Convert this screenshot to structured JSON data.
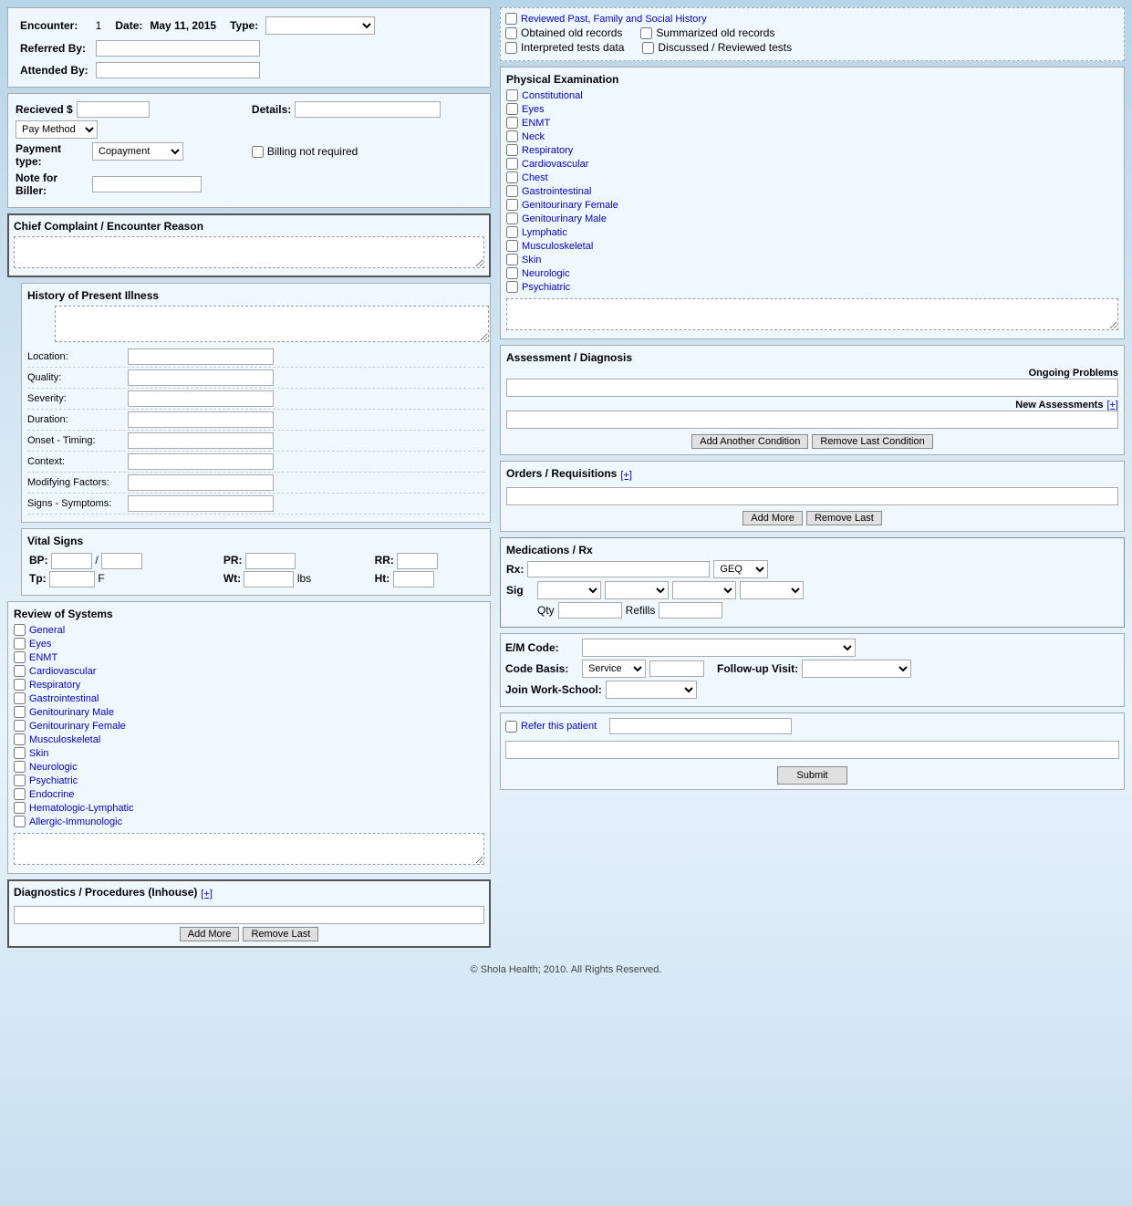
{
  "header": {
    "encounter_label": "Encounter:",
    "encounter_value": "1",
    "date_label": "Date:",
    "date_value": "May 11, 2015",
    "type_label": "Type:",
    "referred_by_label": "Referred By:",
    "attended_by_label": "Attended By:"
  },
  "billing": {
    "received_label": "Recieved $",
    "details_label": "Details:",
    "pay_method_label": "Pay Method",
    "payment_type_label": "Payment type:",
    "payment_type_value": "Copayment",
    "billing_not_required": "Billing not required",
    "note_for_biller_label": "Note for Biller:"
  },
  "chief_complaint": {
    "title": "Chief Complaint / Encounter Reason"
  },
  "hpi": {
    "title": "History of Present Illness",
    "location": "Location:",
    "quality": "Quality:",
    "severity": "Severity:",
    "duration": "Duration:",
    "onset_timing": "Onset - Timing:",
    "context": "Context:",
    "modifying_factors": "Modifying Factors:",
    "signs_symptoms": "Signs - Symptoms:"
  },
  "vital_signs": {
    "title": "Vital Signs",
    "bp": "BP:",
    "pr": "PR:",
    "rr": "RR:",
    "tp": "Tp:",
    "f": "F",
    "wt": "Wt:",
    "lbs": "lbs",
    "ht": "Ht:"
  },
  "review_of_systems": {
    "title": "Review of Systems",
    "items": [
      "General",
      "Eyes",
      "ENMT",
      "Cardiovascular",
      "Respiratory",
      "Gastrointestinal",
      "Genitourinary Male",
      "Genitourinary Female",
      "Musculoskeletal",
      "Skin",
      "Neurologic",
      "Psychiatric",
      "Endocrine",
      "Hematologic-Lymphatic",
      "Allergic-Immunologic"
    ]
  },
  "diagnostics": {
    "title": "Diagnostics / Procedures (Inhouse)",
    "plus": "[+]",
    "add_more": "Add More",
    "remove_last": "Remove Last"
  },
  "right_top": {
    "reviewed_past": "Reviewed Past, Family and Social History",
    "obtained_old": "Obtained old records",
    "summarized_old": "Summarized old records",
    "interpreted_tests": "Interpreted tests data",
    "discussed_reviewed": "Discussed / Reviewed tests"
  },
  "physical_exam": {
    "title": "Physical Examination",
    "items": [
      "Constitutional",
      "Eyes",
      "ENMT",
      "Neck",
      "Respiratory",
      "Cardiovascular",
      "Chest",
      "Gastrointestinal",
      "Genitourinary Female",
      "Genitourinary Male",
      "Lymphatic",
      "Musculoskeletal",
      "Skin",
      "Neurologic",
      "Psychiatric"
    ]
  },
  "assessment": {
    "title": "Assessment / Diagnosis",
    "ongoing_problems": "Ongoing Problems",
    "new_assessments": "New Assessments",
    "plus": "[+]",
    "add_condition": "Add Another Condition",
    "remove_condition": "Remove Last Condition"
  },
  "orders": {
    "title": "Orders / Requisitions",
    "plus": "[+]",
    "add_more": "Add More",
    "remove_last": "Remove Last"
  },
  "medications": {
    "title": "Medications / Rx",
    "rx_label": "Rx:",
    "geq_label": "GEQ",
    "sig_label": "Sig",
    "qty_label": "Qty",
    "refills_label": "Refills"
  },
  "em": {
    "em_code_label": "E/M Code:",
    "code_basis_label": "Code Basis:",
    "service": "Service",
    "follow_up_label": "Follow-up Visit:",
    "join_work_school_label": "Join Work-School:"
  },
  "refer": {
    "refer_patient": "Refer this patient",
    "submit": "Submit"
  },
  "footer": {
    "text": "© Shola Health; 2010. All Rights Reserved."
  }
}
